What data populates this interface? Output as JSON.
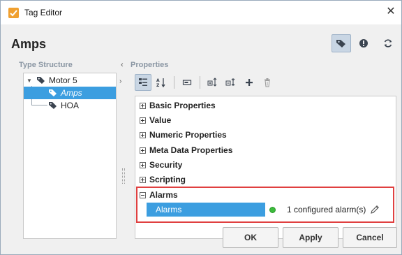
{
  "window": {
    "title": "Tag Editor",
    "close_glyph": "✕"
  },
  "header": {
    "title": "Amps"
  },
  "type_structure": {
    "label": "Type Structure",
    "items": [
      {
        "label": "Motor 5",
        "icon": "tag-icon",
        "expanded": true
      },
      {
        "label": "Amps",
        "icon": "tag-icon",
        "selected": true
      },
      {
        "label": "HOA",
        "icon": "tag-icon"
      }
    ]
  },
  "properties": {
    "label": "Properties",
    "categories": [
      {
        "label": "Basic Properties",
        "expanded": false
      },
      {
        "label": "Value",
        "expanded": false
      },
      {
        "label": "Numeric Properties",
        "expanded": false
      },
      {
        "label": "Meta Data Properties",
        "expanded": false
      },
      {
        "label": "Security",
        "expanded": false
      },
      {
        "label": "Scripting",
        "expanded": false
      },
      {
        "label": "Alarms",
        "expanded": true
      }
    ],
    "alarm_row": {
      "name": "Alarms",
      "value": "1 configured alarm(s)",
      "status_color": "#3cbb3c"
    }
  },
  "buttons": {
    "ok": "OK",
    "apply": "Apply",
    "cancel": "Cancel"
  },
  "colors": {
    "selection": "#3c9ee0",
    "highlight_border": "#e04040",
    "app_icon": "#f0a030"
  }
}
